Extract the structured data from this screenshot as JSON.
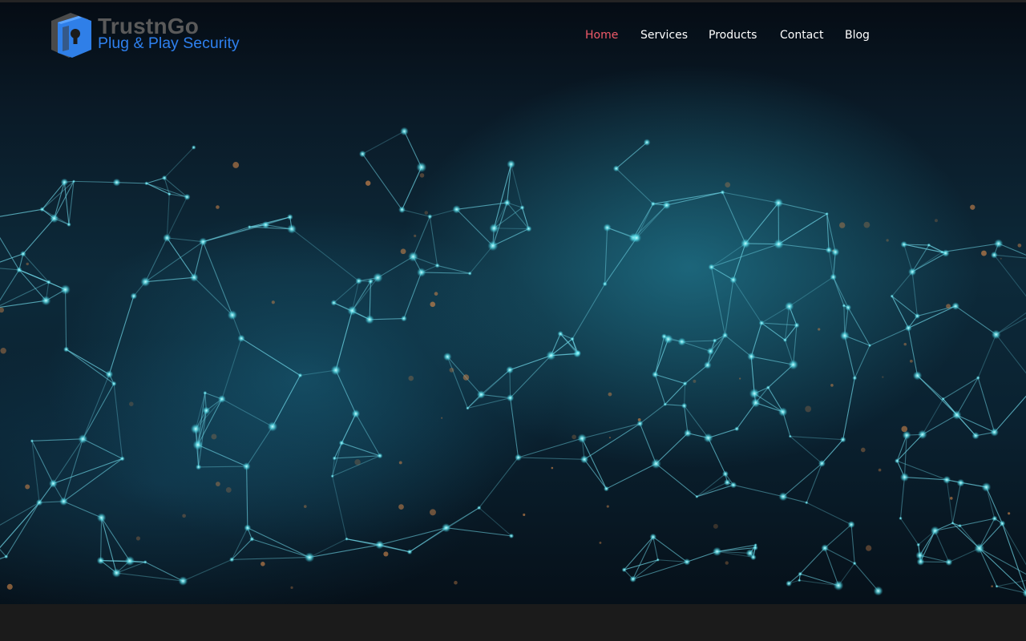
{
  "header": {
    "logo": {
      "icon": "lock-shield-logo",
      "brand_name": "TrustnGo",
      "tagline": "Plug & Play Security"
    },
    "nav": {
      "items": [
        {
          "label": "Home",
          "active": true
        },
        {
          "label": "Services",
          "active": false
        },
        {
          "label": "Products",
          "active": false
        },
        {
          "label": "Contact",
          "active": false
        },
        {
          "label": "Blog",
          "active": false
        }
      ]
    }
  },
  "hero": {
    "image": "network-mesh-background"
  },
  "colors": {
    "nav_active": "#f05a69",
    "nav_text": "#ffffff",
    "brand_blue": "#2e80ee",
    "brand_gray": "#5a5a5a",
    "footer_band": "#1b1b1b"
  }
}
